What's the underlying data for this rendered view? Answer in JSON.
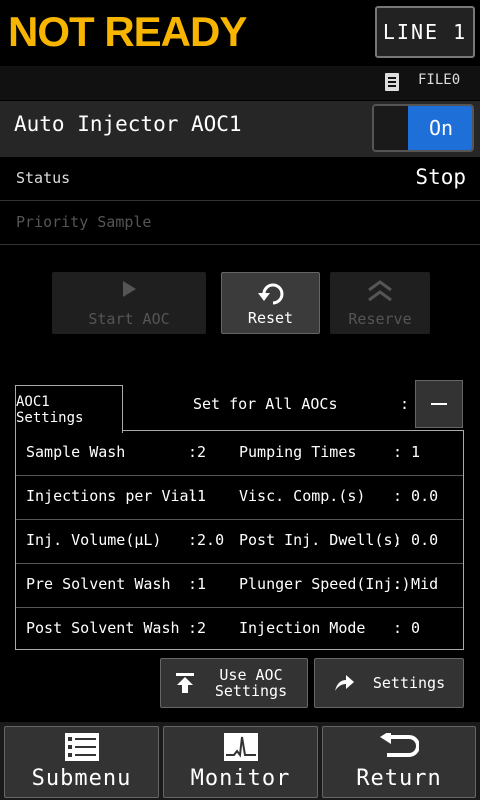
{
  "header": {
    "title": "NOT READY",
    "line_button": "LINE 1"
  },
  "file": {
    "name": "FILE0",
    "icon": "file-icon"
  },
  "aoc": {
    "title": "Auto Injector AOC1",
    "toggle_label": "On"
  },
  "status": {
    "label": "Status",
    "value": "Stop"
  },
  "priority": {
    "label": "Priority Sample"
  },
  "actions": {
    "start": "Start AOC",
    "reset": "Reset",
    "reserve": "Reserve"
  },
  "settings": {
    "tab": "AOC1 Settings",
    "set_all": "Set for All AOCs",
    "colon": ":",
    "rows": [
      {
        "left_label": "Sample Wash",
        "left_value": ":2",
        "right_label": "Pumping Times",
        "right_value": ": 1"
      },
      {
        "left_label": "Injections per Vial",
        "left_value": ":1",
        "right_label": "Visc. Comp.(s)",
        "right_value": ": 0.0"
      },
      {
        "left_label": "Inj. Volume(µL)",
        "left_value": ":2.0",
        "right_label": "Post Inj. Dwell(s)",
        "right_value": ": 0.0"
      },
      {
        "left_label": "Pre Solvent Wash",
        "left_value": ":1",
        "right_label": "Plunger Speed(Inj.)",
        "right_value": ": Mid"
      },
      {
        "left_label": "Post Solvent Wash",
        "left_value": ":2",
        "right_label": "Injection Mode",
        "right_value": ": 0"
      }
    ]
  },
  "bottom": {
    "use_aoc_line1": "Use AOC",
    "use_aoc_line2": "Settings",
    "settings": "Settings"
  },
  "footer": {
    "submenu": "Submenu",
    "monitor": "Monitor",
    "return": "Return"
  },
  "colors": {
    "title": "#f7b500",
    "toggle_on": "#1f6fd8",
    "background": "#000000"
  }
}
